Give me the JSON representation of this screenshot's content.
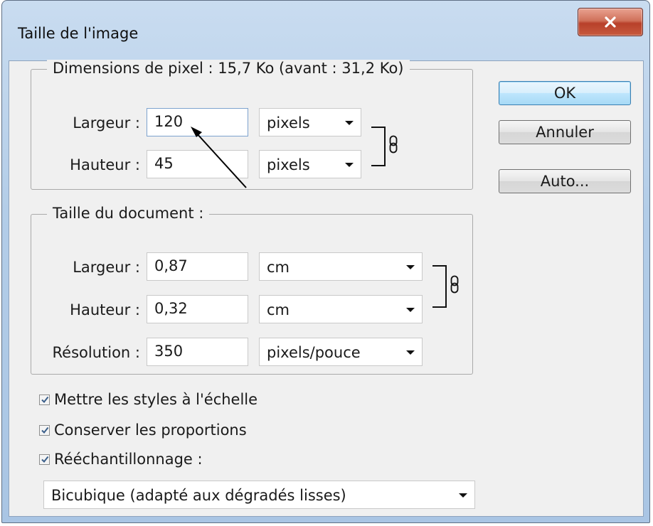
{
  "window": {
    "title": "Taille de l'image"
  },
  "pixel_dimensions": {
    "legend": "Dimensions de pixel :  15,7 Ko (avant : 31,2 Ko)",
    "width": {
      "label": "Largeur :",
      "value": "120",
      "unit": "pixels"
    },
    "height": {
      "label": "Hauteur :",
      "value": "45",
      "unit": "pixels"
    }
  },
  "document_size": {
    "legend": "Taille du document :",
    "width": {
      "label": "Largeur :",
      "value": "0,87",
      "unit": "cm"
    },
    "height": {
      "label": "Hauteur :",
      "value": "0,32",
      "unit": "cm"
    },
    "resolution": {
      "label": "Résolution :",
      "value": "350",
      "unit": "pixels/pouce"
    }
  },
  "options": {
    "scale_styles": {
      "label": "Mettre les styles à l'échelle",
      "checked": true
    },
    "constrain_proportions": {
      "label": "Conserver les proportions",
      "checked": true
    },
    "resample": {
      "label": "Rééchantillonnage :",
      "checked": true
    },
    "resample_method": "Bicubique (adapté aux dégradés lisses)"
  },
  "buttons": {
    "ok": "OK",
    "cancel": "Annuler",
    "auto": "Auto..."
  },
  "icons": {
    "close": "close-icon",
    "chain": "chain-link-icon",
    "check": "check-icon",
    "caret": "chevron-down-icon"
  },
  "colors": {
    "title_bar": "#b3cde8",
    "close_button": "#c75a3e",
    "default_button_border": "#3c7fb1",
    "dialog_background": "#f0f0f0"
  }
}
